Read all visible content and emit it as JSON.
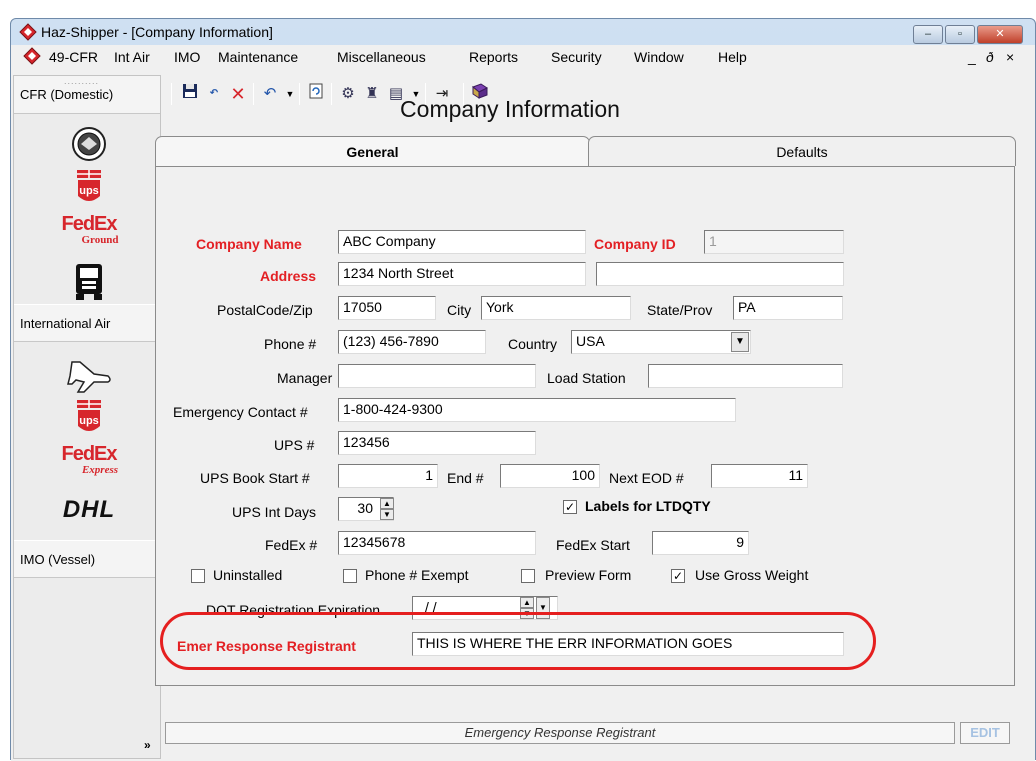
{
  "window": {
    "title": "Haz-Shipper - [Company Information]",
    "caption_buttons": [
      "–",
      "▫",
      "✕"
    ]
  },
  "menubar": {
    "items": [
      "49-CFR",
      "Int Air",
      "IMO",
      "Maintenance",
      "Miscellaneous",
      "Reports",
      "Security",
      "Window",
      "Help"
    ],
    "mdi_controls": [
      "_",
      "ð",
      "×"
    ]
  },
  "leftbar": {
    "sections": {
      "cfr": "CFR (Domestic)",
      "intl_air": "International Air",
      "imo": "IMO (Vessel)"
    },
    "logos": {
      "ups": "ups",
      "fedex": "FedEx",
      "fedex_ground": "Ground",
      "fedex_express": "Express",
      "dhl": "DHL"
    },
    "more": "»"
  },
  "toolbar": {
    "icons": [
      "save-icon",
      "undo-esc-icon",
      "delete-icon",
      "undo-field-icon",
      "refresh-icon",
      "tools-icon",
      "report-icon",
      "print-icon",
      "exit-icon",
      "help-book-icon"
    ]
  },
  "form": {
    "title": "Company Information",
    "tabs": {
      "general": "General",
      "defaults": "Defaults"
    },
    "fields": {
      "company_name_label": "Company Name",
      "company_name": "ABC Company",
      "company_id_label": "Company ID",
      "company_id": "1",
      "address_label": "Address",
      "address1": "1234 North Street",
      "address2": "",
      "postal_label": "PostalCode/Zip",
      "postal": "17050",
      "city_label": "City",
      "city": "York",
      "state_label": "State/Prov",
      "state": "PA",
      "phone_label": "Phone #",
      "phone": "(123) 456-7890",
      "country_label": "Country",
      "country": "USA",
      "manager_label": "Manager",
      "manager": "",
      "load_station_label": "Load Station",
      "load_station": "",
      "emergency_label": "Emergency Contact #",
      "emergency": "1-800-424-9300",
      "ups_label": "UPS #",
      "ups": "123456",
      "ups_book_label": "UPS Book Start #",
      "ups_book_start": "1",
      "end_label": "End #",
      "end": "100",
      "next_eod_label": "Next EOD #",
      "next_eod": "11",
      "ups_int_days_label": "UPS Int Days",
      "ups_int_days": "30",
      "labels_ltdqty": "Labels for LTDQTY",
      "fedex_label": "FedEx #",
      "fedex": "12345678",
      "fedex_start_label": "FedEx Start",
      "fedex_start": "9",
      "uninstalled": "Uninstalled",
      "phone_exempt": "Phone # Exempt",
      "preview_form": "Preview Form",
      "use_gross_weight": "Use Gross Weight",
      "dot_label": "DOT Registration Expiration",
      "dot_value": "/ /",
      "emer_label": "Emer Response Registrant",
      "emer_value": "THIS IS WHERE THE ERR INFORMATION GOES"
    },
    "checkboxes": {
      "labels_ltdqty": true,
      "uninstalled": false,
      "phone_exempt": false,
      "preview_form": false,
      "use_gross_weight": true
    }
  },
  "statusbar": {
    "message": "Emergency Response Registrant",
    "mode": "EDIT"
  },
  "colors": {
    "required_label": "#e32024",
    "highlight": "#e51f1f",
    "titlebar": "#cfe0f2"
  }
}
